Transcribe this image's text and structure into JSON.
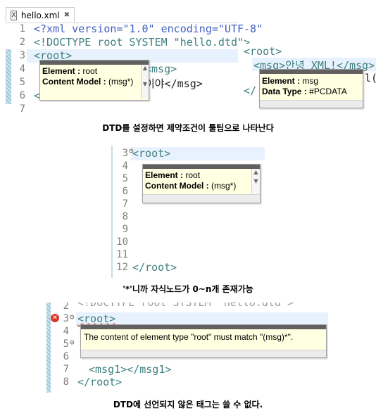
{
  "panel1": {
    "tab_label": "hello.xml",
    "lines": [
      {
        "num": "1",
        "text": "<?xml version=\"1.0\" encoding=\"UTF-8\""
      },
      {
        "num": "2",
        "text": "<!DOCTYPE root SYSTEM \"hello.dtd\">"
      },
      {
        "num": "3",
        "text": "<root>"
      },
      {
        "num": "4",
        "text": "<msg>"
      },
      {
        "num": "5",
        "text": "이야</msg>"
      },
      {
        "num": "6",
        "text": "<"
      },
      {
        "num": "7",
        "text": ""
      }
    ],
    "tooltip": {
      "element_label": "Element :",
      "element_value": "root",
      "model_label": "Content Model :",
      "model_value": "(msg*)"
    },
    "right": {
      "root_tag": "<root>",
      "msg_line": "<msg>안녕 XML!</msg>",
      "close_frag": "</",
      "trail_char": "l(",
      "tooltip": {
        "element_label": "Element :",
        "element_value": "msg",
        "type_label": "Data Type :",
        "type_value": "#PCDATA"
      }
    }
  },
  "caption1": "DTD를 설정하면 제약조건이 툴팁으로 나타난다",
  "panel2": {
    "line_numbers": [
      "3",
      "4",
      "5",
      "6",
      "7",
      "8",
      "9",
      "10",
      "11",
      "12"
    ],
    "root_open": "<root>",
    "root_close": "</root>",
    "tooltip": {
      "element_label": "Element :",
      "element_value": "root",
      "model_label": "Content Model :",
      "model_value": "(msg*)"
    }
  },
  "caption2": "'*'니까 자식노드가 0~n개 존재가능",
  "panel3": {
    "top_fragment": "<!DOCTYPE root SYSTEM \"hello.dtd\">",
    "line_numbers": [
      "2",
      "3",
      "4",
      "5",
      "6",
      "7",
      "8"
    ],
    "root_open": "<root>",
    "msg_line": "<msg1></msg1>",
    "root_close": "</root>",
    "error_message": "The content of element type \"root\" must match \"(msg)*\"."
  },
  "caption3": "DTD에 선언되지 않은 태그는 쓸 수 없다."
}
